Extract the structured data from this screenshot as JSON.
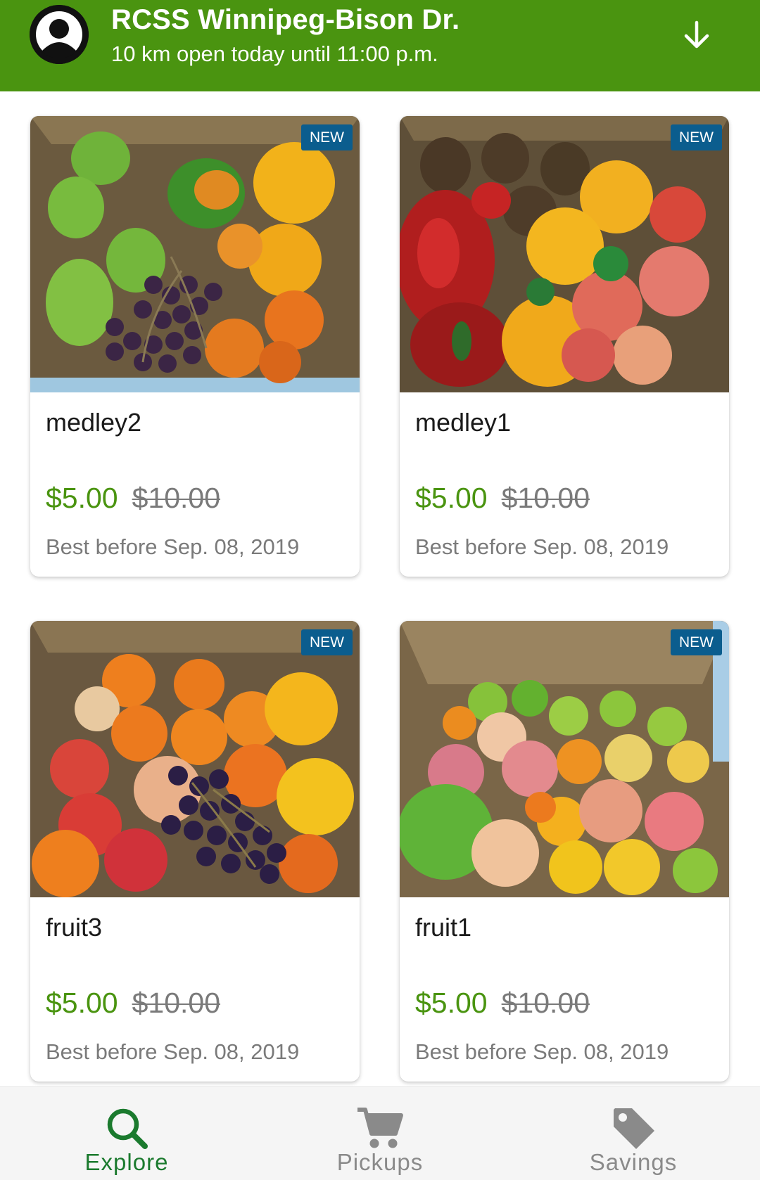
{
  "header": {
    "store_name": "RCSS Winnipeg-Bison Dr.",
    "store_info": "10 km open today until 11:00 p.m.",
    "avatar_icon": "user-avatar-icon",
    "expand_icon": "arrow-down-icon",
    "background": "#4a9410"
  },
  "products": [
    {
      "badge": "NEW",
      "name": "medley2",
      "price": "$5.00",
      "original_price": "$10.00",
      "best_before": "Best before Sep. 08, 2019"
    },
    {
      "badge": "NEW",
      "name": "medley1",
      "price": "$5.00",
      "original_price": "$10.00",
      "best_before": "Best before Sep. 08, 2019"
    },
    {
      "badge": "NEW",
      "name": "fruit3",
      "price": "$5.00",
      "original_price": "$10.00",
      "best_before": "Best before Sep. 08, 2019"
    },
    {
      "badge": "NEW",
      "name": "fruit1",
      "price": "$5.00",
      "original_price": "$10.00",
      "best_before": "Best before Sep. 08, 2019"
    }
  ],
  "bottom_nav": {
    "items": [
      {
        "label": "Explore",
        "icon": "search-icon",
        "active": true
      },
      {
        "label": "Pickups",
        "icon": "cart-icon",
        "active": false
      },
      {
        "label": "Savings",
        "icon": "tag-icon",
        "active": false
      }
    ],
    "active_color": "#1b7a2e",
    "inactive_color": "#8a8a8a"
  },
  "colors": {
    "price": "#4a9410",
    "badge": "#0b5d8e",
    "muted_text": "#7a7a7a"
  }
}
